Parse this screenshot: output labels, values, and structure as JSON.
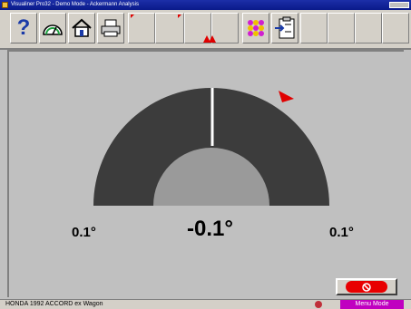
{
  "window": {
    "title": "Visualiner Pro32 - Demo Mode - Ackermann Analysis"
  },
  "toolbar": {
    "buttons": [
      {
        "name": "help-button",
        "icon": "question-icon"
      },
      {
        "name": "measure-button",
        "icon": "gauge-icon"
      },
      {
        "name": "home-button",
        "icon": "home-icon"
      },
      {
        "name": "print-button",
        "icon": "printer-icon"
      },
      {
        "name": "targets-button",
        "icon": "targets-icon"
      },
      {
        "name": "clipboard-button",
        "icon": "clipboard-export-icon"
      }
    ]
  },
  "gauge": {
    "left_limit": "0.1°",
    "value": "-0.1°",
    "right_limit": "0.1°",
    "pointer_color": "#e00000",
    "arc_color": "#3c3c3c",
    "inner_color": "#9a9a9a"
  },
  "status": {
    "vehicle": "HONDA  1992  ACCORD  ex  Wagon",
    "menu_mode": "Menu Mode"
  },
  "colors": {
    "accent": "#c000c0",
    "stop": "#e80000"
  }
}
